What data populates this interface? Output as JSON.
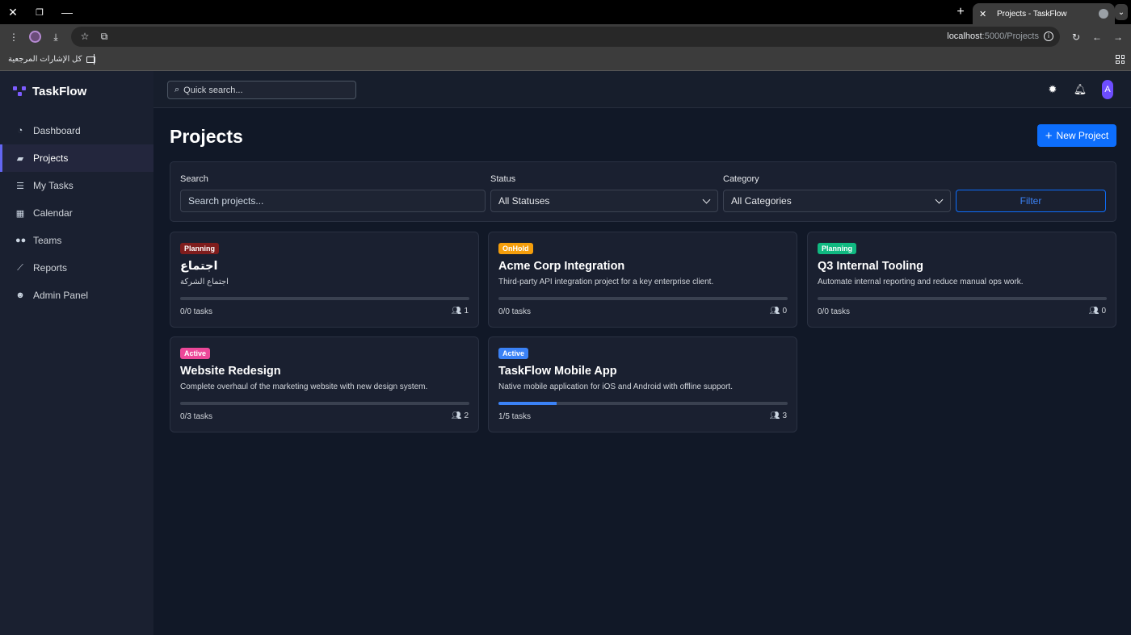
{
  "browser": {
    "tab_title": "Projects - TaskFlow",
    "url_host": "localhost",
    "url_path": ":5000/Projects",
    "bookmarks_label": "كل الإشارات المرجعية"
  },
  "app": {
    "brand": "TaskFlow",
    "nav": [
      {
        "label": "Dashboard",
        "icon": "dashboard-icon",
        "active": false
      },
      {
        "label": "Projects",
        "icon": "folder-icon",
        "active": true
      },
      {
        "label": "My Tasks",
        "icon": "tasks-icon",
        "active": false
      },
      {
        "label": "Calendar",
        "icon": "calendar-icon",
        "active": false
      },
      {
        "label": "Teams",
        "icon": "teams-icon",
        "active": false
      },
      {
        "label": "Reports",
        "icon": "chart-icon",
        "active": false
      },
      {
        "label": "Admin Panel",
        "icon": "admin-icon",
        "active": false
      }
    ],
    "quick_search_placeholder": "Quick search...",
    "avatar_letter": "A"
  },
  "page": {
    "title": "Projects",
    "new_button": "New Project"
  },
  "filters": {
    "search_label": "Search",
    "search_placeholder": "Search projects...",
    "status_label": "Status",
    "status_value": "All Statuses",
    "category_label": "Category",
    "category_value": "All Categories",
    "filter_button": "Filter"
  },
  "projects": [
    {
      "status": "Planning",
      "badge_bg": "#7f1d1d",
      "badge_fg": "#ffffff",
      "title": "اجتماع",
      "description": "اجتماع الشركة",
      "tasks": "0/0 tasks",
      "progress": 0,
      "members": "1"
    },
    {
      "status": "OnHold",
      "badge_bg": "#f59e0b",
      "badge_fg": "#ffffff",
      "title": "Acme Corp Integration",
      "description": "Third-party API integration project for a key enterprise client.",
      "tasks": "0/0 tasks",
      "progress": 0,
      "members": "0"
    },
    {
      "status": "Planning",
      "badge_bg": "#10b981",
      "badge_fg": "#ffffff",
      "title": "Q3 Internal Tooling",
      "description": "Automate internal reporting and reduce manual ops work.",
      "tasks": "0/0 tasks",
      "progress": 0,
      "members": "0"
    },
    {
      "status": "Active",
      "badge_bg": "#ec4899",
      "badge_fg": "#ffffff",
      "title": "Website Redesign",
      "description": "Complete overhaul of the marketing website with new design system.",
      "tasks": "0/3 tasks",
      "progress": 0,
      "members": "2"
    },
    {
      "status": "Active",
      "badge_bg": "#3b82f6",
      "badge_fg": "#ffffff",
      "title": "TaskFlow Mobile App",
      "description": "Native mobile application for iOS and Android with offline support.",
      "tasks": "1/5 tasks",
      "progress": 0.2,
      "members": "3"
    }
  ]
}
